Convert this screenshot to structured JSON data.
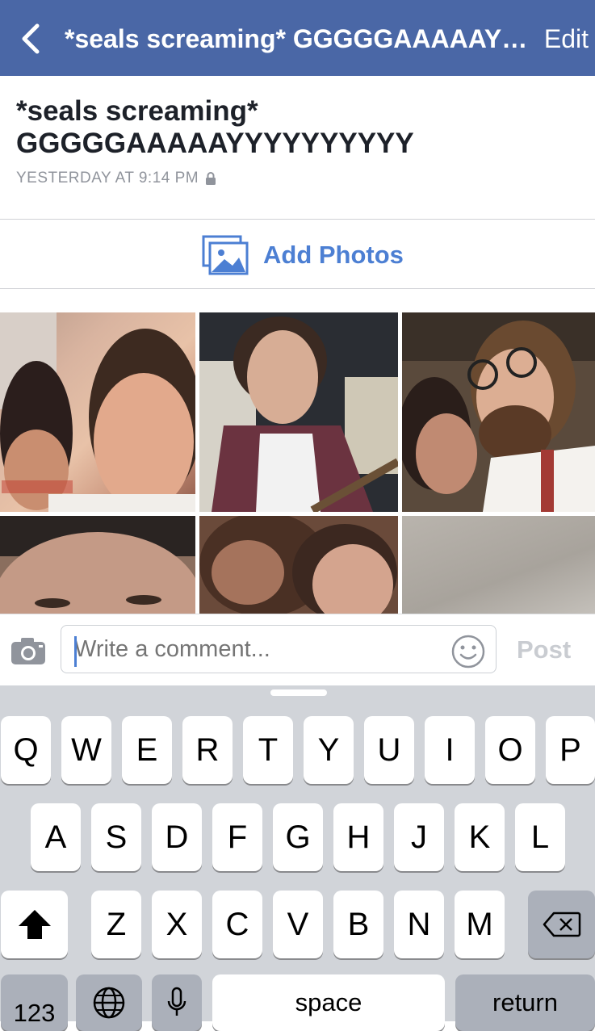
{
  "nav": {
    "title": "*seals screaming* GGGGGAAAAAYYYYYYYYYY",
    "edit_label": "Edit"
  },
  "album": {
    "title": "*seals screaming* GGGGGAAAAAYYYYYYYYYY",
    "timestamp": "YESTERDAY AT 9:14 PM"
  },
  "add_photos": {
    "label": "Add Photos"
  },
  "comment": {
    "placeholder": "Write a comment...",
    "post_label": "Post"
  },
  "keyboard": {
    "row1": [
      "Q",
      "W",
      "E",
      "R",
      "T",
      "Y",
      "U",
      "I",
      "O",
      "P"
    ],
    "row2": [
      "A",
      "S",
      "D",
      "F",
      "G",
      "H",
      "J",
      "K",
      "L"
    ],
    "row3": [
      "Z",
      "X",
      "C",
      "V",
      "B",
      "N",
      "M"
    ],
    "numbers_label": "123",
    "space_label": "space",
    "return_label": "return"
  },
  "colors": {
    "nav_bg": "#4a67a6",
    "accent_blue": "#4c7fd3",
    "keyboard_bg": "#d1d4d9"
  },
  "icons": [
    "chevron-left-icon",
    "lock-icon",
    "photo-icon",
    "camera-icon",
    "emoji-icon",
    "shift-icon",
    "backspace-icon",
    "globe-icon",
    "microphone-icon"
  ]
}
